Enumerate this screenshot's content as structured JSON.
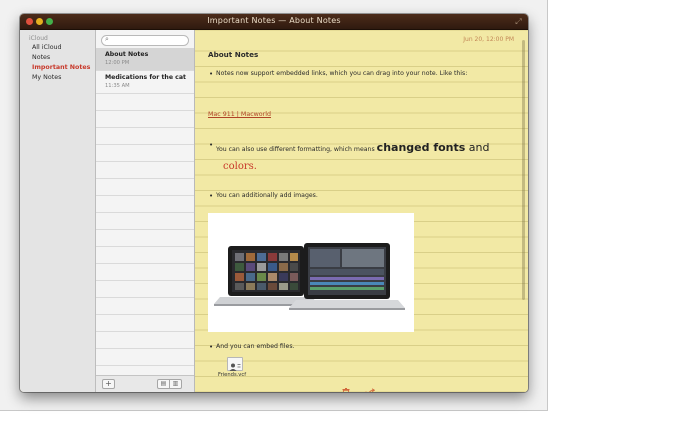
{
  "window": {
    "title": "Important Notes — About Notes"
  },
  "sidebar": {
    "section": "iCloud",
    "items": [
      {
        "label": "All iCloud"
      },
      {
        "label": "Notes"
      },
      {
        "label": "Important Notes",
        "selected": true
      },
      {
        "label": "My Notes"
      }
    ]
  },
  "notes_list": {
    "search_placeholder": "",
    "notes": [
      {
        "title": "About Notes",
        "time": "12:00 PM",
        "selected": true
      },
      {
        "title": "Medications for the cat",
        "time": "11:35 AM",
        "selected": false
      }
    ]
  },
  "note": {
    "date": "Jun 20, 12:00 PM",
    "title": "About Notes",
    "bullet1": "Notes now support embedded links, which you can drag into your note. Like this:",
    "link": "Mac 911 | Macworld",
    "bullet2_prefix": "You can also use different formatting, which means ",
    "bullet2_big": "changed fonts",
    "bullet2_and": " and",
    "bullet2_colors": "colors.",
    "bullet3": "You can additionally add images.",
    "bullet4": "And you can embed files.",
    "attachment_name": "Friends.vcf"
  },
  "icons": [
    "search-icon",
    "add-icon",
    "trash-icon",
    "share-icon",
    "vcard-icon"
  ],
  "colors": {
    "accent_red": "#c8392b",
    "paper": "#f2e9a5",
    "titlebar": "#3f2415"
  }
}
